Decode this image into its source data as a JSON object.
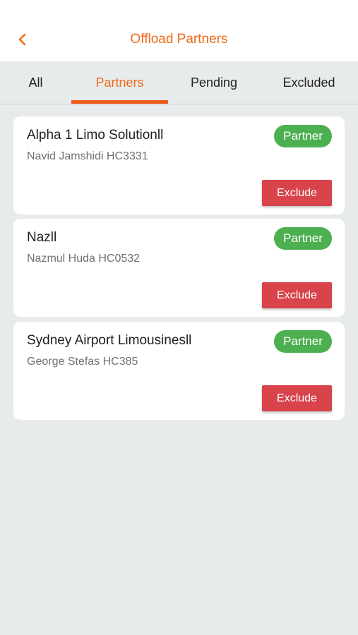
{
  "header": {
    "title": "Offload Partners",
    "back_icon": "chevron-left-icon"
  },
  "tabs": [
    {
      "label": "All",
      "active": false
    },
    {
      "label": "Partners",
      "active": true
    },
    {
      "label": "Pending",
      "active": false
    },
    {
      "label": "Excluded",
      "active": false
    }
  ],
  "partners": [
    {
      "name": "Alpha 1 Limo Solutionll",
      "contact": "Navid Jamshidi HC3331",
      "badge": "Partner",
      "action": "Exclude"
    },
    {
      "name": "Nazll",
      "contact": "Nazmul Huda HC0532",
      "badge": "Partner",
      "action": "Exclude"
    },
    {
      "name": "Sydney Airport Limousinesll",
      "contact": "George Stefas HC385",
      "badge": "Partner",
      "action": "Exclude"
    }
  ],
  "colors": {
    "accent": "#ee6a1b",
    "badge": "#4caf50",
    "exclude": "#d9434b",
    "background": "#e8ebec"
  }
}
